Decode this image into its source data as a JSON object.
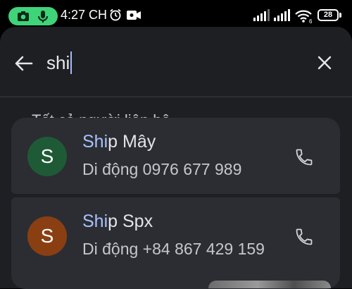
{
  "status_bar": {
    "time": "4:27 CH",
    "battery": "28",
    "network_label": "6",
    "icons": [
      "camera-icon",
      "microphone-icon",
      "alarm-icon",
      "video-icon",
      "signal-icon",
      "wifi-icon",
      "battery-icon"
    ],
    "indicator_color": "#3fd37a"
  },
  "search": {
    "query": "shi",
    "back_icon": "arrow-back-icon",
    "clear_icon": "close-icon"
  },
  "section_title": "Tất cả người liên hệ",
  "contacts": [
    {
      "initial": "S",
      "name_match": "Shi",
      "name_rest": "p Mây",
      "phone": "Di động 0976 677 989",
      "avatar_color": "#1f5a37"
    },
    {
      "initial": "S",
      "name_match": "Shi",
      "name_rest": "p Spx",
      "phone": "Di động +84 867 429 159",
      "avatar_color": "#8a3f13"
    }
  ],
  "colors": {
    "sheet_bg": "#1d1f23",
    "card_bg": "#2b2d32",
    "match_highlight": "#a9c2ff"
  }
}
